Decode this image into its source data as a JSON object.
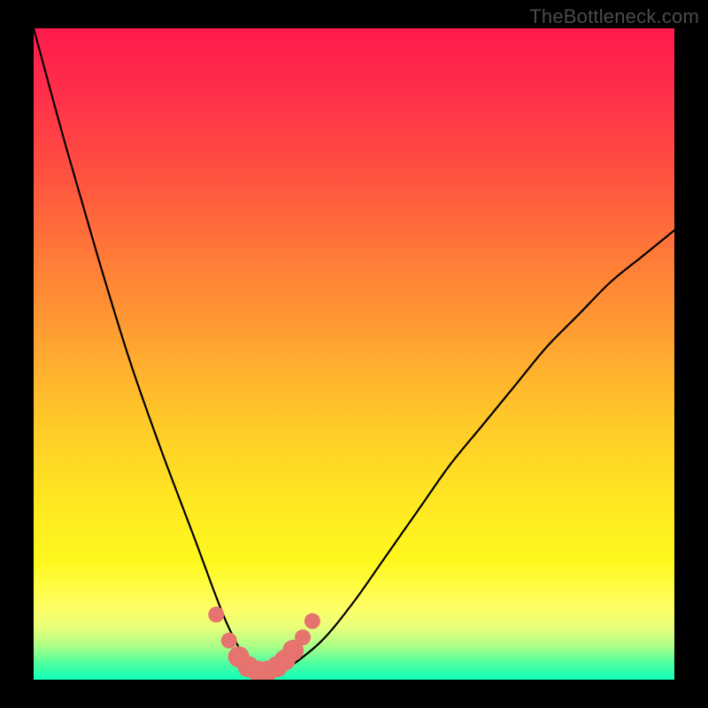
{
  "watermark": "TheBottleneck.com",
  "chart_data": {
    "type": "line",
    "title": "",
    "xlabel": "",
    "ylabel": "",
    "xlim": [
      0,
      100
    ],
    "ylim": [
      0,
      100
    ],
    "series": [
      {
        "name": "bottleneck-curve",
        "x": [
          0,
          5,
          10,
          15,
          20,
          25,
          28,
          30,
          32,
          34,
          36,
          38,
          40,
          45,
          50,
          55,
          60,
          65,
          70,
          75,
          80,
          85,
          90,
          95,
          100
        ],
        "y": [
          100,
          82,
          65,
          49,
          35,
          22,
          14,
          9,
          5,
          2,
          1,
          1,
          2,
          6,
          12,
          19,
          26,
          33,
          39,
          45,
          51,
          56,
          61,
          65,
          69
        ]
      }
    ],
    "markers": {
      "name": "highlight-dots",
      "x": [
        28.5,
        30.5,
        32.0,
        33.5,
        35.0,
        36.5,
        38.0,
        39.2,
        40.5,
        42.0,
        43.5
      ],
      "y": [
        10.0,
        6.0,
        3.5,
        2.0,
        1.3,
        1.3,
        2.0,
        3.0,
        4.5,
        6.5,
        9.0
      ]
    },
    "colors": {
      "curve": "#000000",
      "marker": "#e6736e",
      "gradient_top": "#ff1a4d",
      "gradient_bottom": "#11ffb8"
    }
  }
}
